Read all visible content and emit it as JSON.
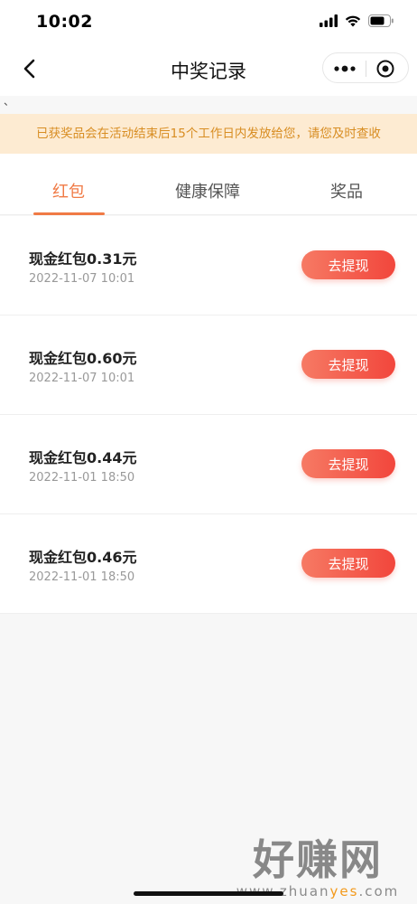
{
  "status": {
    "time": "10:02"
  },
  "nav": {
    "title": "中奖记录"
  },
  "stray_mark": "、",
  "notice": "已获奖品会在活动结束后15个工作日内发放给您，请您及时查收",
  "tabs": [
    {
      "label": "红包",
      "active": true
    },
    {
      "label": "健康保障",
      "active": false
    },
    {
      "label": "奖品",
      "active": false
    }
  ],
  "records": [
    {
      "title": "现金红包0.31元",
      "time": "2022-11-07 10:01",
      "action": "去提现"
    },
    {
      "title": "现金红包0.60元",
      "time": "2022-11-07 10:01",
      "action": "去提现"
    },
    {
      "title": "现金红包0.44元",
      "time": "2022-11-01 18:50",
      "action": "去提现"
    },
    {
      "title": "现金红包0.46元",
      "time": "2022-11-01 18:50",
      "action": "去提现"
    }
  ],
  "watermark": {
    "big": "好赚网",
    "small_pre": "www.zhuan",
    "small_hl": "yes",
    "small_post": ".com"
  },
  "colors": {
    "accent": "#f07a45",
    "notice_bg": "#fdebd2",
    "notice_text": "#d88d22",
    "button_start": "#f67a64",
    "button_end": "#f2463c"
  }
}
